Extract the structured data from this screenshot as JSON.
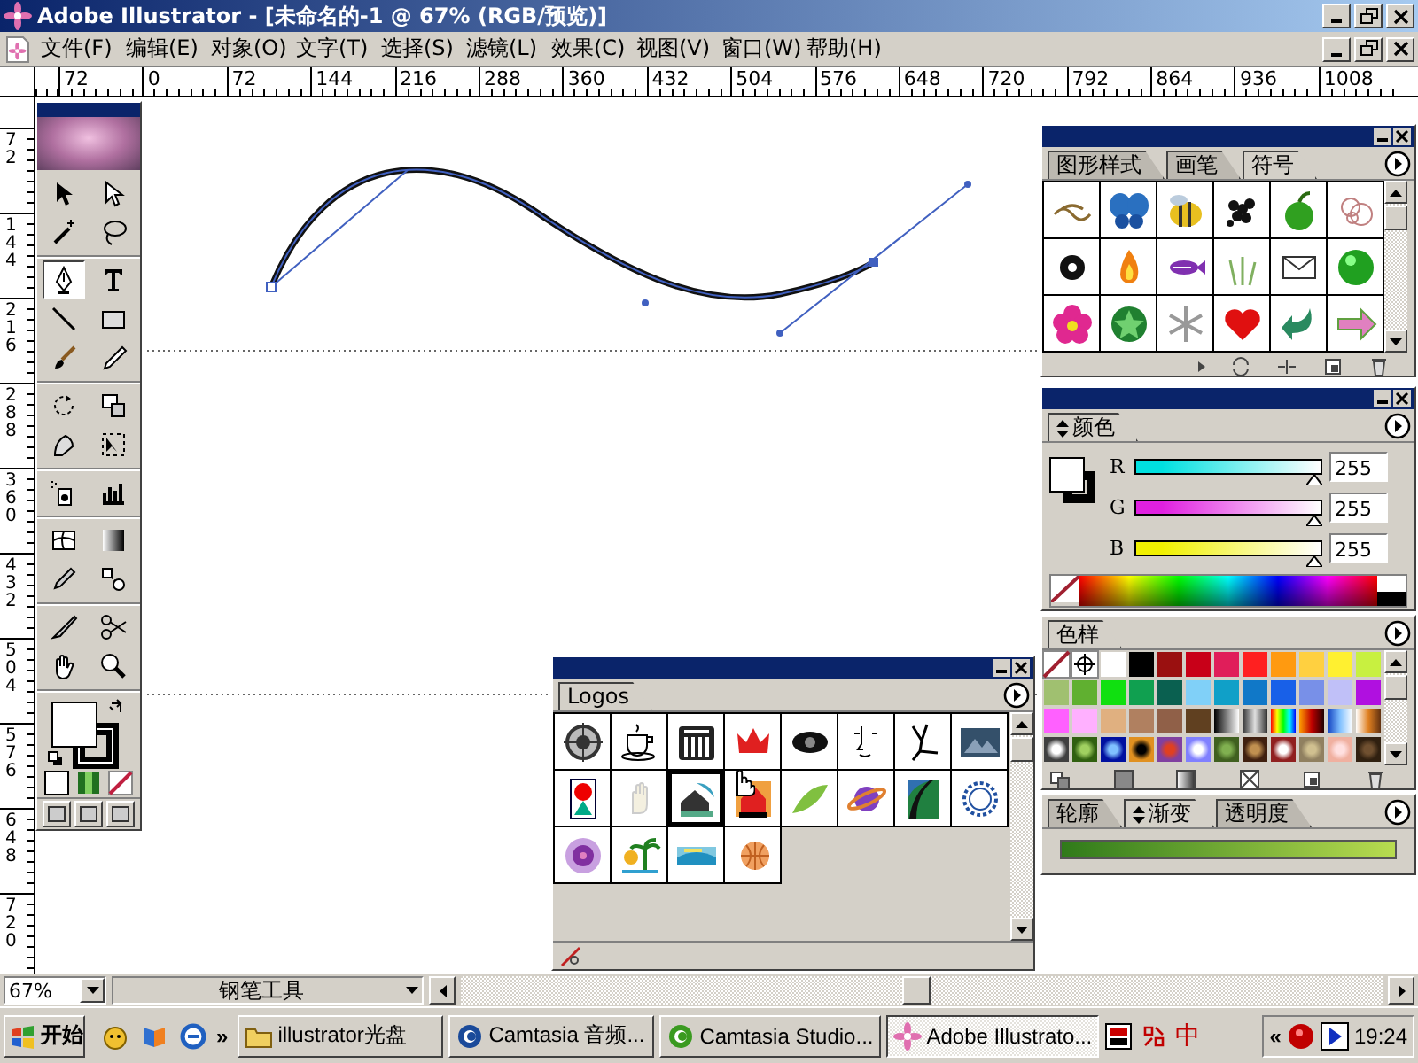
{
  "window": {
    "title": "Adobe Illustrator - [未命名的-1 @ 67% (RGB/预览)]"
  },
  "menu": [
    "文件(F)",
    "编辑(E)",
    "对象(O)",
    "文字(T)",
    "选择(S)",
    "滤镜(L)",
    "效果(C)",
    "视图(V)",
    "窗口(W)",
    "帮助(H)"
  ],
  "rulers": {
    "horizontal": [
      "72",
      "0",
      "72",
      "144",
      "216",
      "288",
      "360",
      "432",
      "504",
      "576",
      "648",
      "720",
      "792",
      "864",
      "936",
      "1008"
    ],
    "vertical": [
      "72",
      "144",
      "216",
      "288",
      "360",
      "432",
      "504",
      "576",
      "648",
      "720"
    ]
  },
  "toolbox": {
    "tools": [
      {
        "selected": false
      },
      {
        "selected": false
      },
      {
        "selected": false
      },
      {
        "selected": false
      },
      {
        "selected": true
      },
      {
        "selected": false
      },
      {
        "selected": false
      },
      {
        "selected": false
      },
      {
        "selected": false
      },
      {
        "selected": false
      },
      {
        "selected": false
      },
      {
        "selected": false
      },
      {
        "selected": false
      },
      {
        "selected": false
      },
      {
        "selected": false
      },
      {
        "selected": false
      },
      {
        "selected": false
      },
      {
        "selected": false
      },
      {
        "selected": false
      },
      {
        "selected": false
      },
      {
        "selected": false
      },
      {
        "selected": false
      },
      {
        "selected": false
      },
      {
        "selected": false
      }
    ]
  },
  "symbols_palette": {
    "tabs": [
      {
        "label": "图形样式",
        "selected": false
      },
      {
        "label": "画笔",
        "selected": false
      },
      {
        "label": "符号",
        "selected": true
      }
    ]
  },
  "color_palette": {
    "tab": "颜色",
    "channels": [
      {
        "name": "R",
        "value": "255",
        "level": 1,
        "color": "#00e0e0"
      },
      {
        "name": "G",
        "value": "255",
        "level": 1,
        "color": "#e020e0"
      },
      {
        "name": "B",
        "value": "255",
        "level": 1,
        "color": "#f0f000"
      }
    ]
  },
  "swatches_palette": {
    "tab": "色样",
    "swatches": [
      {
        "kind": "none"
      },
      {
        "kind": "registration"
      },
      {
        "kind": "solid",
        "color": "#ffffff"
      },
      {
        "kind": "solid",
        "color": "#000000"
      },
      {
        "kind": "solid",
        "color": "#9a1010"
      },
      {
        "kind": "solid",
        "color": "#c80018"
      },
      {
        "kind": "solid",
        "color": "#e01e5a"
      },
      {
        "kind": "solid",
        "color": "#ff2020"
      },
      {
        "kind": "solid",
        "color": "#ff9a10"
      },
      {
        "kind": "solid",
        "color": "#ffd040"
      },
      {
        "kind": "solid",
        "color": "#fff030"
      },
      {
        "kind": "solid",
        "color": "#c8f040"
      },
      {
        "kind": "solid",
        "color": "#a0c070"
      },
      {
        "kind": "solid",
        "color": "#60b030"
      },
      {
        "kind": "solid",
        "color": "#10e010"
      },
      {
        "kind": "solid",
        "color": "#10a050"
      },
      {
        "kind": "solid",
        "color": "#0a6050"
      },
      {
        "kind": "solid",
        "color": "#80d0f8"
      },
      {
        "kind": "solid",
        "color": "#10a0c8"
      },
      {
        "kind": "solid",
        "color": "#1078c8"
      },
      {
        "kind": "solid",
        "color": "#1860e8"
      },
      {
        "kind": "solid",
        "color": "#7890e8"
      },
      {
        "kind": "solid",
        "color": "#c0c0f8"
      },
      {
        "kind": "solid",
        "color": "#b010e0"
      },
      {
        "kind": "solid",
        "color": "#ff60ff"
      },
      {
        "kind": "solid",
        "color": "#ffb0ff"
      },
      {
        "kind": "solid",
        "color": "#e0b080"
      },
      {
        "kind": "solid",
        "color": "#b08060"
      },
      {
        "kind": "solid",
        "color": "#906048"
      },
      {
        "kind": "solid",
        "color": "#604020"
      },
      {
        "kind": "gradient"
      },
      {
        "kind": "gradient"
      },
      {
        "kind": "gradient"
      },
      {
        "kind": "gradient"
      },
      {
        "kind": "gradient"
      },
      {
        "kind": "gradient"
      },
      {
        "kind": "pattern"
      },
      {
        "kind": "pattern"
      },
      {
        "kind": "pattern"
      },
      {
        "kind": "pattern"
      },
      {
        "kind": "pattern"
      },
      {
        "kind": "pattern"
      },
      {
        "kind": "pattern"
      },
      {
        "kind": "pattern"
      },
      {
        "kind": "pattern"
      },
      {
        "kind": "pattern"
      },
      {
        "kind": "pattern"
      },
      {
        "kind": "pattern"
      }
    ]
  },
  "gradient_palette": {
    "tabs": [
      {
        "label": "轮廓",
        "selected": false
      },
      {
        "label": "渐变",
        "selected": true
      },
      {
        "label": "透明度",
        "selected": false
      }
    ]
  },
  "logos_palette": {
    "tab": "Logos",
    "items": [
      {
        "selected": false
      },
      {
        "selected": false
      },
      {
        "selected": false
      },
      {
        "selected": false
      },
      {
        "selected": false
      },
      {
        "selected": false
      },
      {
        "selected": false
      },
      {
        "selected": false
      },
      {
        "selected": false
      },
      {
        "selected": false
      },
      {
        "selected": true
      },
      {
        "selected": false
      },
      {
        "selected": false
      },
      {
        "selected": false
      },
      {
        "selected": false
      },
      {
        "selected": false
      },
      {
        "selected": false
      },
      {
        "selected": false
      },
      {
        "selected": false
      },
      {
        "selected": false
      }
    ]
  },
  "status_bar": {
    "zoom": "67%",
    "tool": "钢笔工具"
  },
  "taskbar": {
    "start": "开始",
    "more": "»",
    "tasks": [
      {
        "label": "illustrator光盘",
        "selected": false
      },
      {
        "label": "Camtasia 音频...",
        "selected": false
      },
      {
        "label": "Camtasia Studio...",
        "selected": false
      },
      {
        "label": "Adobe Illustrato...",
        "selected": true
      }
    ],
    "ime": "中",
    "tray_toggle": "«",
    "clock": "19:24"
  }
}
